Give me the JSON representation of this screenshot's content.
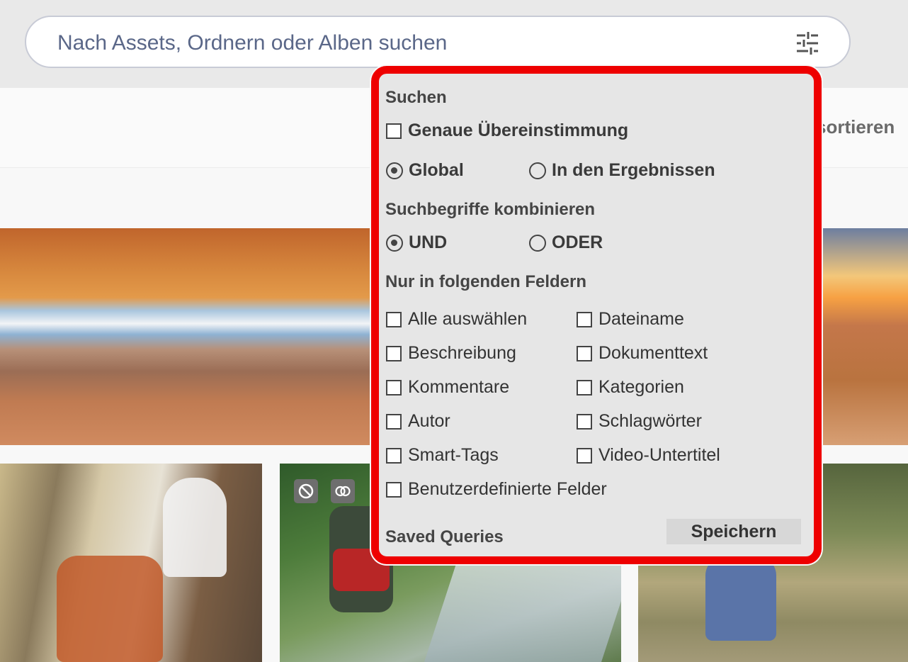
{
  "search": {
    "placeholder": "Nach Assets, Ordnern oder Alben suchen",
    "filter_icon": "sliders-icon"
  },
  "toolbar": {
    "sort_label": "sortieren"
  },
  "images": [
    {
      "name": "desert-arch-photo"
    },
    {
      "name": "sunset-canyon-photo"
    },
    {
      "name": "train-traveler-photo"
    },
    {
      "name": "hiker-stream-photo",
      "badges": [
        "no-entry-icon",
        "linked-rings-icon"
      ]
    },
    {
      "name": "backpack-grass-photo"
    }
  ],
  "popup": {
    "highlight_color": "#ee0000",
    "search_title": "Suchen",
    "exact_match": "Genaue Übereinstimmung",
    "scope": {
      "options": [
        "Global",
        "In den Ergebnissen"
      ],
      "selected": "Global"
    },
    "combine_title": "Suchbegriffe kombinieren",
    "combine": {
      "options": [
        "UND",
        "ODER"
      ],
      "selected": "UND"
    },
    "fields_title": "Nur in folgenden Feldern",
    "fields": [
      "Alle auswählen",
      "Dateiname",
      "Beschreibung",
      "Dokumenttext",
      "Kommentare",
      "Kategorien",
      "Autor",
      "Schlagwörter",
      "Smart-Tags",
      "Video-Untertitel",
      "Benutzerdefinierte Felder"
    ],
    "saved_queries_label": "Saved Queries",
    "save_button": "Speichern"
  }
}
